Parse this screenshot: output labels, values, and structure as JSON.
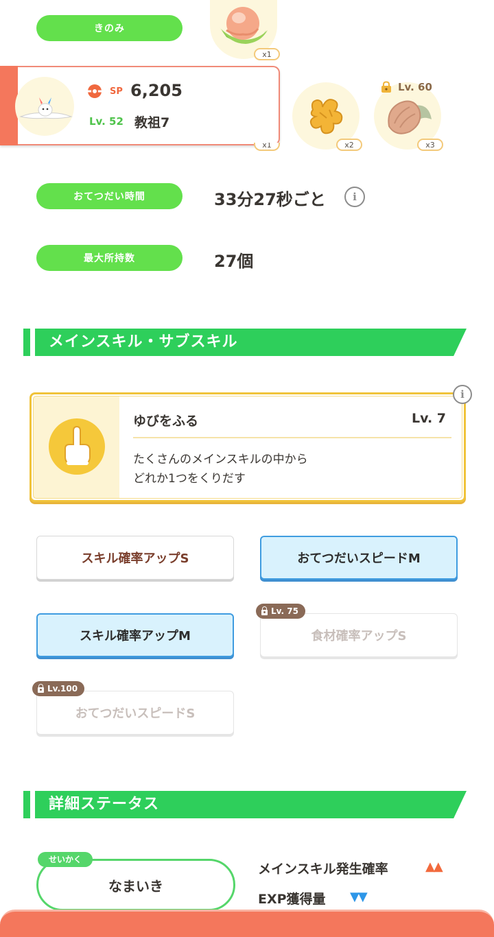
{
  "berry": {
    "label": "きのみ",
    "qty": "x1"
  },
  "pokemon": {
    "sp_label": "SP",
    "sp_value": "6,205",
    "level": "Lv. 52",
    "name": "教祖7",
    "hidden_qty": "x1"
  },
  "ingredients": [
    {
      "qty": "x2",
      "icon": "ginger-icon"
    },
    {
      "qty": "x3",
      "icon": "cacao-icon",
      "lock_level": "Lv. 60"
    }
  ],
  "help_time": {
    "label": "おてつだい時間",
    "value": "33分27秒ごと"
  },
  "max_carry": {
    "label": "最大所持数",
    "value": "27個"
  },
  "skills_section": {
    "title": "メインスキル・サブスキル"
  },
  "main_skill": {
    "name": "ゆびをふる",
    "level": "Lv. 7",
    "desc_line1": "たくさんのメインスキルの中から",
    "desc_line2": "どれか1つをくりだす"
  },
  "sub_skills": [
    {
      "label": "スキル確率アップS",
      "state": "normal"
    },
    {
      "label": "おてつだいスピードM",
      "state": "selected"
    },
    {
      "label": "スキル確率アップM",
      "state": "selected"
    },
    {
      "label": "食材確率アップS",
      "state": "locked",
      "lock_level": "Lv. 75"
    },
    {
      "label": "おてつだいスピードS",
      "state": "locked",
      "lock_level": "Lv.100"
    }
  ],
  "detail_section": {
    "title": "詳細ステータス"
  },
  "nature": {
    "tag": "せいかく",
    "value": "なまいき",
    "effects": [
      {
        "label": "メインスキル発生確率",
        "arrows": "▲▲",
        "color": "#f26a3d"
      },
      {
        "label": "EXP獲得量",
        "arrows": "▼▼",
        "color": "#2d96e8"
      }
    ]
  },
  "colors": {
    "green": "#63e04c",
    "section_green": "#2ecf5b",
    "accent_orange": "#f4775c",
    "gold": "#f0c33a",
    "blue": "#3f9ce0"
  }
}
